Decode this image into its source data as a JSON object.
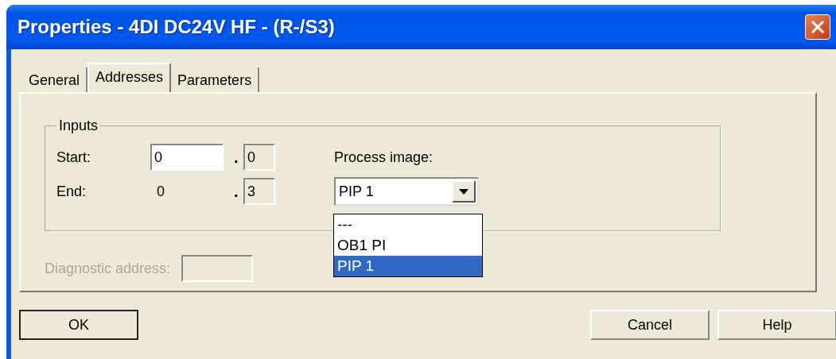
{
  "window": {
    "title": "Properties - 4DI DC24V HF - (R-/S3)"
  },
  "tabs": [
    {
      "label": "General",
      "selected": false
    },
    {
      "label": "Addresses",
      "selected": true
    },
    {
      "label": "Parameters",
      "selected": false
    }
  ],
  "inputs_group": {
    "title": "Inputs",
    "rows": [
      {
        "label": "Start:",
        "byte": "0",
        "byte_editable": true,
        "separator": ".",
        "bit": "0"
      },
      {
        "label": "End:",
        "byte": "0",
        "byte_editable": false,
        "separator": ".",
        "bit": "3"
      }
    ]
  },
  "process_image": {
    "label": "Process image:",
    "value": "PIP 1",
    "expanded": true,
    "options": [
      {
        "label": "---",
        "selected": false
      },
      {
        "label": "OB1 PI",
        "selected": false
      },
      {
        "label": "PIP 1",
        "selected": true
      }
    ]
  },
  "diagnostic_address": {
    "label": "Diagnostic address:",
    "disabled": true
  },
  "buttons": [
    {
      "label": "OK",
      "default": true
    },
    {
      "label": "Cancel",
      "default": false
    },
    {
      "label": "Help",
      "default": false
    }
  ]
}
